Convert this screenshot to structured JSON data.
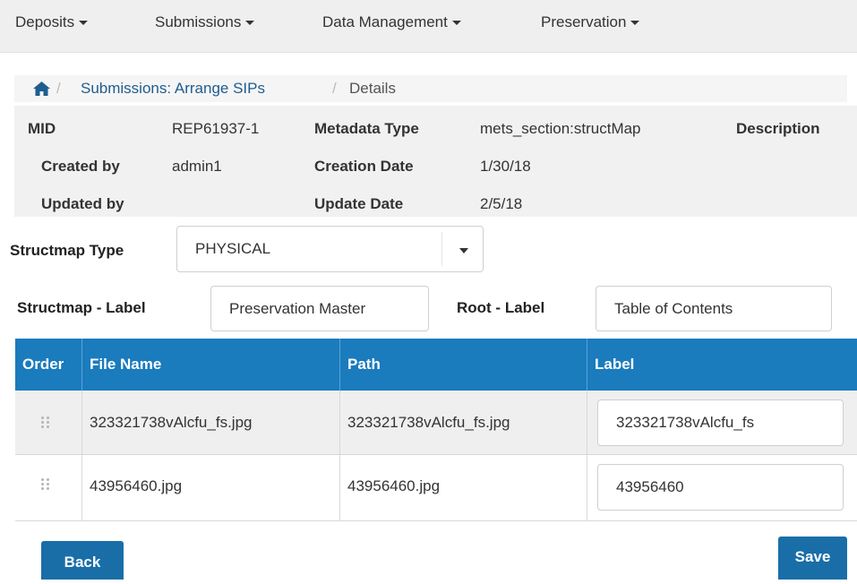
{
  "menu": {
    "items": [
      {
        "label": "Deposits"
      },
      {
        "label": "Submissions"
      },
      {
        "label": "Data Management"
      },
      {
        "label": "Preservation"
      }
    ]
  },
  "breadcrumb": {
    "home_icon": "home-icon",
    "separator": "/",
    "link": "Submissions: Arrange SIPs",
    "current": "Details"
  },
  "details": {
    "mid_label": "MID",
    "mid_value": "REP61937-1",
    "metadata_type_label": "Metadata Type",
    "metadata_type_value": "mets_section:structMap",
    "description_label": "Description",
    "created_by_label": "Created by",
    "created_by_value": "admin1",
    "creation_date_label": "Creation Date",
    "creation_date_value": "1/30/18",
    "updated_by_label": "Updated by",
    "update_date_label": "Update Date",
    "update_date_value": "2/5/18"
  },
  "form": {
    "structmap_type_label": "Structmap Type",
    "structmap_type_value": "PHYSICAL",
    "structmap_label_label": "Structmap - Label",
    "structmap_label_value": "Preservation Master",
    "root_label_label": "Root - Label",
    "root_label_value": "Table of Contents"
  },
  "table": {
    "headers": [
      "Order",
      "File Name",
      "Path",
      "Label"
    ],
    "rows": [
      {
        "file_name": "323321738vAlcfu_fs.jpg",
        "path": "323321738vAlcfu_fs.jpg",
        "label": "323321738vAlcfu_fs"
      },
      {
        "file_name": "43956460.jpg",
        "path": "43956460.jpg",
        "label": "43956460"
      }
    ]
  },
  "buttons": {
    "back": "Back",
    "save": "Save"
  },
  "colors": {
    "table_header": "#1a7bbd",
    "button": "#1a6ea8",
    "link": "#1f5d8f",
    "panel": "#f1f1f1"
  }
}
